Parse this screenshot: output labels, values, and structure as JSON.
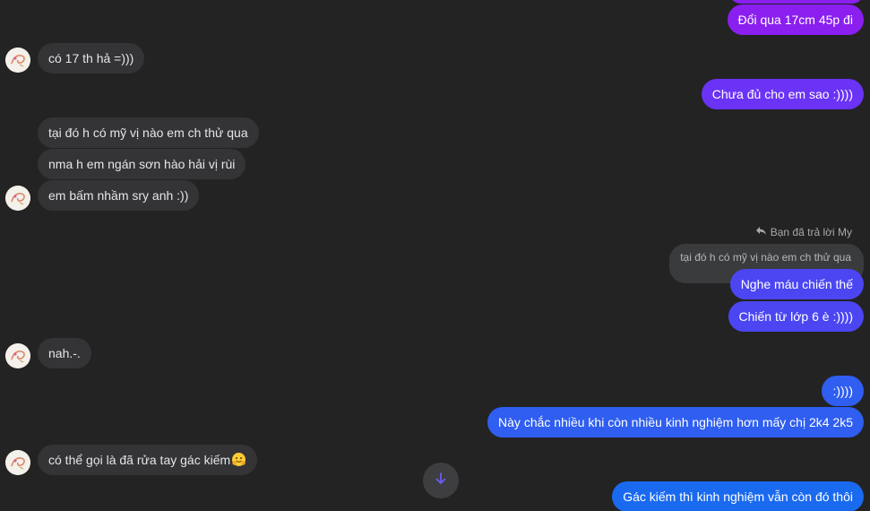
{
  "messages": {
    "top_out": "Đổi qua 17cm 45p đi",
    "m1_in": "có 17 th hả =)))",
    "m2_out": "Chưa đủ cho em sao :))))",
    "m3_in": "tại đó h có mỹ vị nào em ch thử qua",
    "m4_in": "nma h em ngán sơn hào hải vị rùi",
    "m5_in": "em bấm nhầm sry anh :))",
    "reply_label": "Bạn đã trả lời My",
    "quoted": "tại đó h có mỹ vị nào em ch thử qua",
    "m6_out": "Nghe máu chiến thế",
    "m7_out": "Chiến từ lớp 6 è :))))",
    "m8_in": "nah.-.",
    "m9_out": ":))))",
    "m10_out": "Này chắc nhiều khi còn nhiều kinh nghiệm hơn mấy chị 2k4 2k5",
    "m11_in": "có thể gọi là đã rửa tay gác kiếm",
    "m12_out": "Gác kiếm thì kinh nghiệm vẫn còn đó thôi"
  },
  "icons": {
    "reply": "reply-arrow-icon",
    "scroll": "arrow-down-icon",
    "emoji": "hugging-face-emoji"
  },
  "colors": {
    "background": "#232324",
    "incoming_bubble": "#343436",
    "outgoing_gradient": [
      "#8a1ff0",
      "#6b33f5",
      "#4b46f2",
      "#2f5ef0",
      "#1a6af0"
    ]
  }
}
